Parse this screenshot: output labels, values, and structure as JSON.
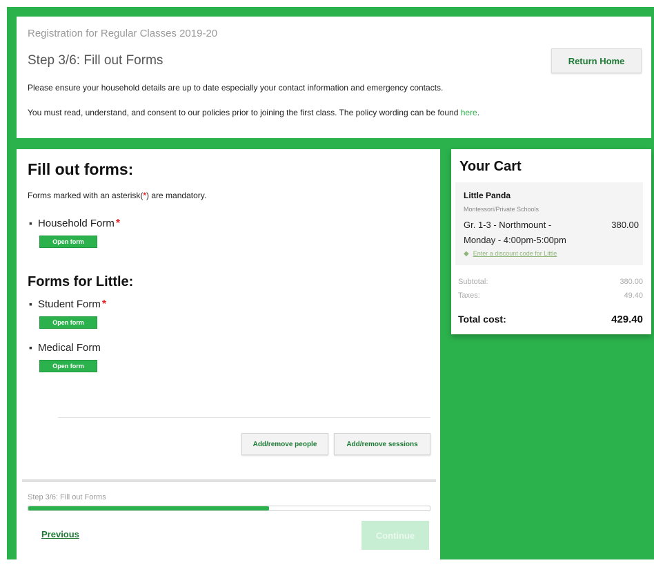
{
  "header": {
    "registration_title": "Registration for Regular Classes 2019-20",
    "step_title": "Step 3/6: Fill out Forms",
    "return_home_label": "Return Home",
    "info_household": "Please ensure your household details are up to date especially your contact information and emergency contacts.",
    "info_policy_prefix": "You must read, understand, and consent to our policies prior to joining the first class. The policy wording can be found ",
    "info_policy_link": "here",
    "info_policy_suffix": "."
  },
  "forms": {
    "heading": "Fill out forms:",
    "mandatory_prefix": "Forms marked with an asterisk(",
    "mandatory_asterisk": "*",
    "mandatory_suffix": ") are mandatory.",
    "household": {
      "name": "Household Form",
      "asterisk": "*",
      "button": "Open form"
    },
    "little_heading": "Forms for Little:",
    "student": {
      "name": "Student Form",
      "asterisk": "*",
      "button": "Open form"
    },
    "medical": {
      "name": "Medical Form",
      "button": "Open form"
    },
    "add_people_label": "Add/remove people",
    "add_sessions_label": "Add/remove sessions"
  },
  "footer": {
    "progress_label": "Step 3/6: Fill out Forms",
    "progress_fraction": 0.6,
    "previous_label": "Previous",
    "continue_label": "Continue"
  },
  "cart": {
    "heading": "Your Cart",
    "item": {
      "name": "Little Panda",
      "subtitle": "Montessori/Private Schools",
      "line1": "Gr. 1-3 - Northmount -",
      "line2": "Monday - 4:00pm-5:00pm",
      "price": "380.00",
      "discount_label": "Enter a discount code for Little"
    },
    "subtotal_label": "Subtotal:",
    "subtotal_value": "380.00",
    "taxes_label": "Taxes:",
    "taxes_value": "49.40",
    "total_label": "Total cost:",
    "total_value": "429.40"
  },
  "colors": {
    "brand_green": "#2bb24c",
    "asterisk_red": "#e5262a"
  }
}
